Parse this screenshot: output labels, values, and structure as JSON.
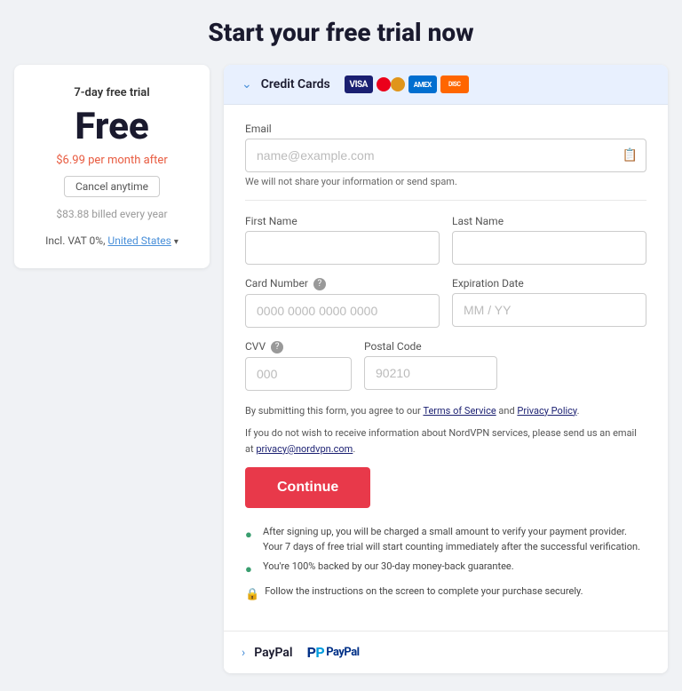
{
  "page": {
    "title": "Start your free trial now"
  },
  "left_panel": {
    "trial_label": "7-day free trial",
    "price": "Free",
    "per_month": "$6.99 per month after",
    "cancel_label": "Cancel anytime",
    "billed_note": "$83.88 billed every year",
    "vat_label": "Incl. VAT 0%,",
    "country": "United States",
    "chevron": "▾"
  },
  "payment": {
    "credit_card_label": "Credit Cards",
    "chevron_down": "⌄",
    "card_types": [
      "Visa",
      "Mastercard",
      "Amex",
      "Discover"
    ],
    "paypal_label": "PayPal",
    "paypal_logo": "PayPal",
    "chevron_right": "›"
  },
  "form": {
    "email_label": "Email",
    "email_placeholder": "name@example.com",
    "spam_note": "We will not share your information or send spam.",
    "first_name_label": "First Name",
    "last_name_label": "Last Name",
    "card_number_label": "Card Number",
    "card_number_placeholder": "0000 0000 0000 0000",
    "expiry_label": "Expiration Date",
    "expiry_placeholder": "MM / YY",
    "cvv_label": "CVV",
    "cvv_placeholder": "000",
    "postal_label": "Postal Code",
    "postal_placeholder": "90210",
    "legal_1": "By submitting this form, you agree to our ",
    "tos_link": "Terms of Service",
    "and": " and ",
    "privacy_link": "Privacy Policy",
    "legal_2": ".",
    "legal_3": "If you do not wish to receive information about NordVPN services, please send us an email at ",
    "privacy_email": "privacy@nordvpn.com",
    "legal_4": ".",
    "continue_label": "Continue"
  },
  "guarantees": [
    "After signing up, you will be charged a small amount to verify your payment provider. Your 7 days of free trial will start counting immediately after the successful verification.",
    "You're 100% backed by our 30-day money-back guarantee.",
    "Follow the instructions on the screen to complete your purchase securely."
  ],
  "icons": {
    "email": "📧",
    "check": "●",
    "shield": "●",
    "lock": "🔒"
  }
}
